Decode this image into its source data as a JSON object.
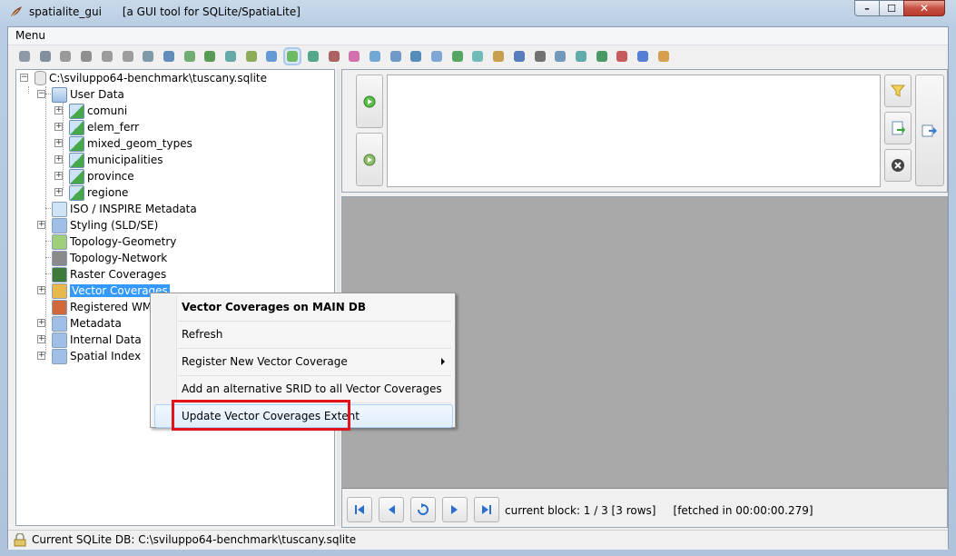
{
  "window": {
    "title": "spatialite_gui      [a GUI tool for SQLite/SpatiaLite]",
    "min_glyph": "–",
    "max_glyph": "☐",
    "close_glyph": "✕"
  },
  "menubar": {
    "menu_label": "Menu"
  },
  "toolbar": {
    "icons": [
      "connect-icon",
      "connect-readonly-icon",
      "create-db-icon",
      "create-memory-db-icon",
      "disconnect-icon",
      "memory-db-load-icon",
      "memory-db-save-icon",
      "vacuum-icon",
      "sql-script-icon",
      "load-shapefile-icon",
      "virtual-shapefile-icon",
      "load-dbf-icon",
      "virtual-dbf-icon",
      "load-xl-icon",
      "virtual-xl-icon",
      "network-icon",
      "exif-icon",
      "gps-icon",
      "xml-icon",
      "wfs-icon",
      "dxf-icon",
      "svg-icon",
      "srid-icon",
      "attach-icon",
      "sql-log-icon",
      "db-status-icon",
      "check-geometries-icon",
      "sanitize-geometries-icon",
      "map-icon",
      "about-icon",
      "help-icon",
      "exit-icon"
    ],
    "selected_index": 13
  },
  "tree": {
    "root": "C:\\sviluppo64-benchmark\\tuscany.sqlite",
    "user_data": "User Data",
    "tables": [
      "comuni",
      "elem_ferr",
      "mixed_geom_types",
      "municipalities",
      "province",
      "regione"
    ],
    "nodes": [
      "ISO / INSPIRE Metadata",
      "Styling (SLD/SE)",
      "Topology-Geometry",
      "Topology-Network",
      "Raster Coverages",
      "Vector Coverages",
      "Registered WMS",
      "Metadata",
      "Internal Data",
      "Spatial Index"
    ],
    "selected": "Vector Coverages"
  },
  "context_menu": {
    "header": "Vector Coverages on MAIN DB",
    "items": [
      "Refresh",
      "Register New Vector Coverage",
      "Add an alternative SRID to all Vector Coverages",
      "Update Vector Coverages Extent"
    ],
    "highlighted": "Update Vector Coverages Extent"
  },
  "result_nav": {
    "status": "current block: 1 / 3 [3 rows]     [fetched in 00:00:00.279]"
  },
  "statusbar": {
    "text": "Current SQLite DB: C:\\sviluppo64-benchmark\\tuscany.sqlite"
  },
  "colors": {
    "selection": "#3399ff",
    "annotation": "#e3131b",
    "grid_background": "#a9a9a9"
  }
}
